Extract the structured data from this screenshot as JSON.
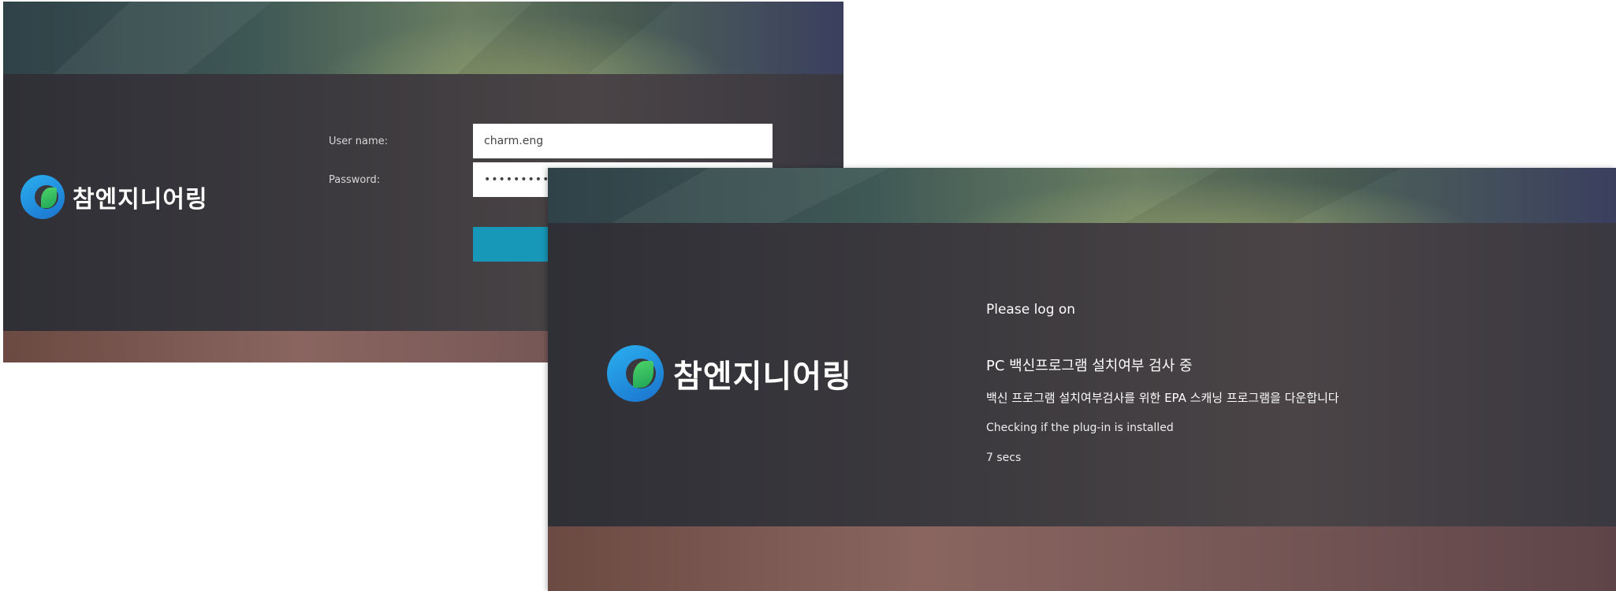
{
  "login_screen": {
    "brand_name": "참엔지니어링",
    "username_label": "User name:",
    "password_label": "Password:",
    "username_value": "charm.eng",
    "password_value": "••••••••••"
  },
  "scan_screen": {
    "brand_name": "참엔지니어링",
    "title": "Please log on",
    "heading": "PC 백신프로그램 설치여부 검사 중",
    "subheading": "백신 프로그램 설치여부검사를 위한 EPA 스캐닝 프로그램을 다운합니다",
    "checking_text": "Checking if the plug-in is installed",
    "elapsed": "7 secs"
  },
  "colors": {
    "brand_blue": "#1a72cc",
    "brand_green": "#1ea555",
    "login_button": "#1798b8"
  }
}
